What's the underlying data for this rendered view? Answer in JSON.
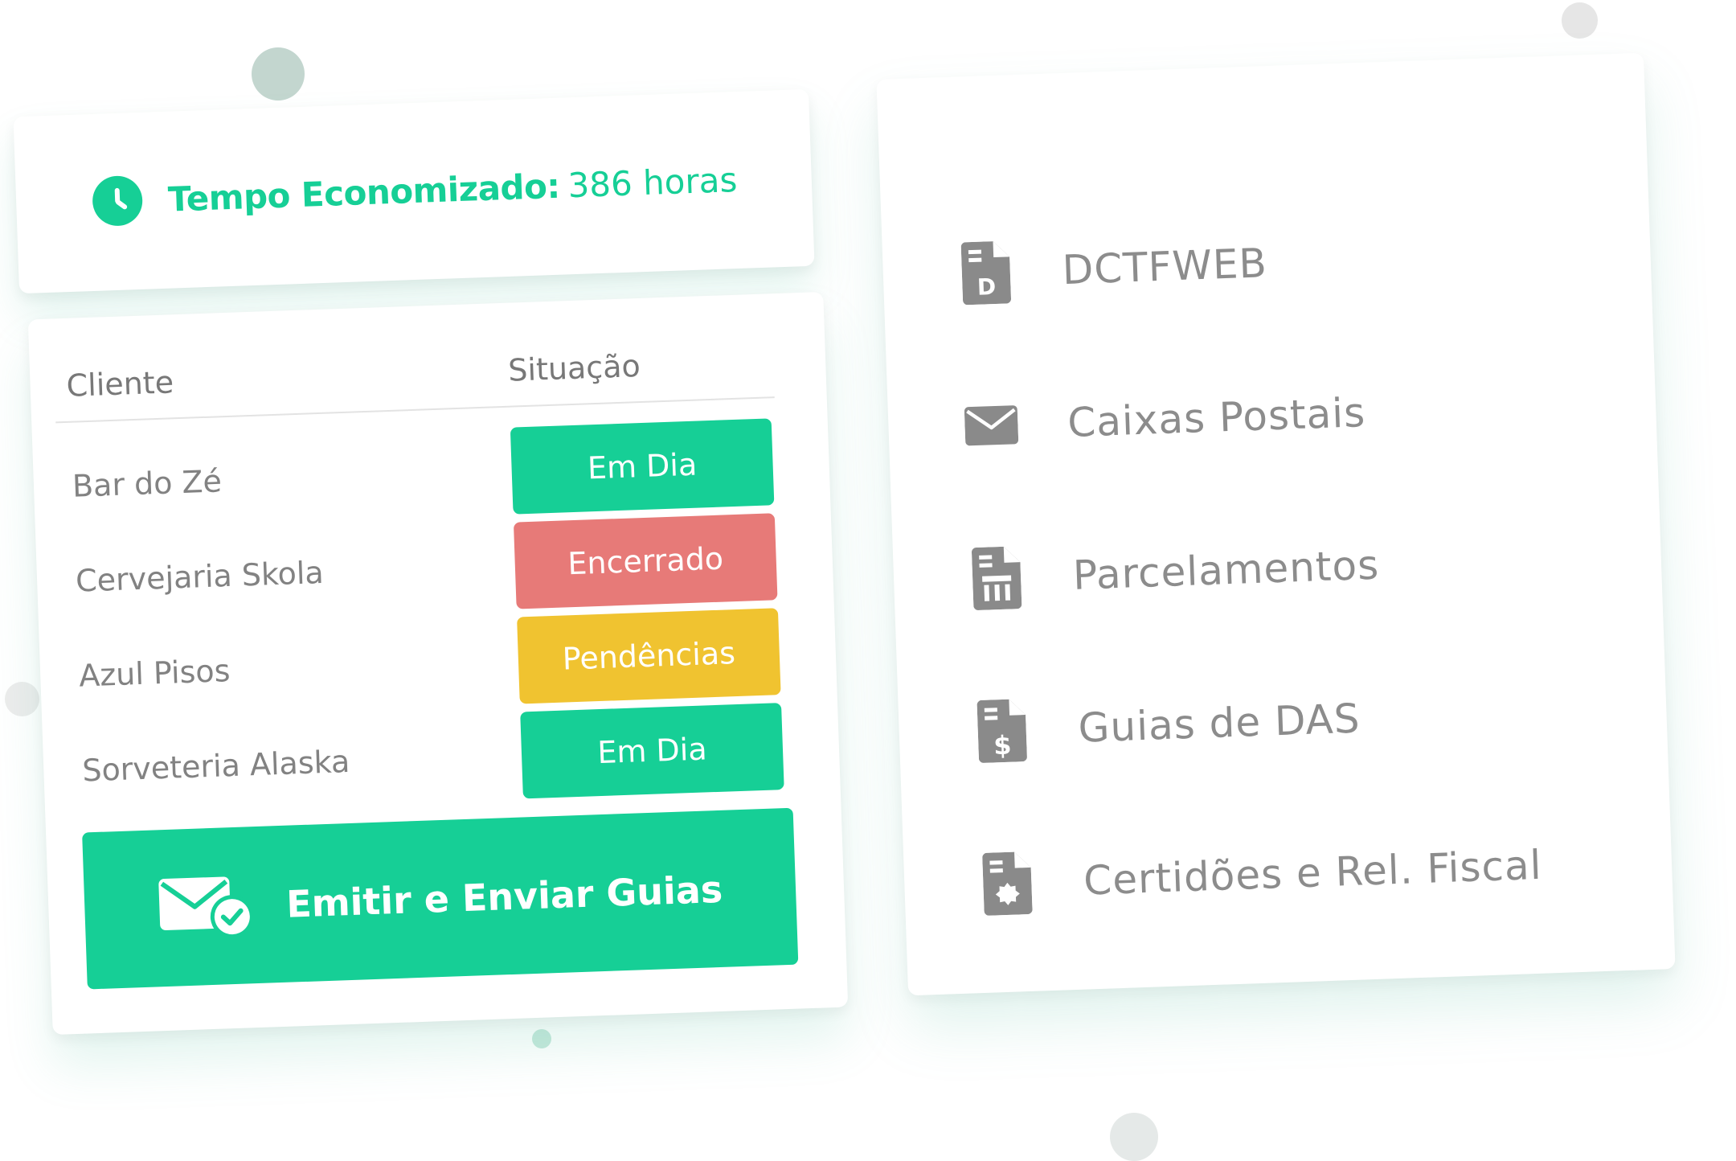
{
  "time_saved": {
    "label": "Tempo Economizado:",
    "value": "386 horas"
  },
  "clients_table": {
    "headers": {
      "client": "Cliente",
      "status": "Situação"
    },
    "rows": [
      {
        "name": "Bar do Zé",
        "status": "Em Dia",
        "status_color": "#16cf96"
      },
      {
        "name": "Cervejaria Skola",
        "status": "Encerrado",
        "status_color": "#e77a78"
      },
      {
        "name": "Azul Pisos",
        "status": "Pendências",
        "status_color": "#f0c330"
      },
      {
        "name": "Sorveteria Alaska",
        "status": "Em Dia",
        "status_color": "#16cf96"
      }
    ],
    "action_label": "Emitir e Enviar Guias"
  },
  "services": [
    {
      "label": "DCTFWEB",
      "icon": "document-d-icon"
    },
    {
      "label": "Caixas Postais",
      "icon": "envelope-icon"
    },
    {
      "label": "Parcelamentos",
      "icon": "document-bars-icon"
    },
    {
      "label": "Guias de DAS",
      "icon": "document-dollar-icon"
    },
    {
      "label": "Certidões e Rel. Fiscal",
      "icon": "document-seal-icon"
    }
  ],
  "colors": {
    "accent": "#16cf96",
    "danger": "#e77a78",
    "warning": "#f0c330",
    "muted_text": "#828282",
    "icon_gray": "#8a8a8a"
  }
}
